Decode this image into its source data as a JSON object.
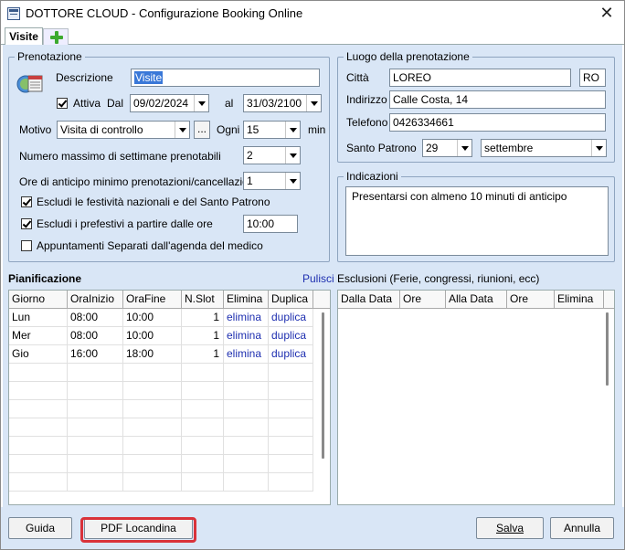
{
  "window": {
    "title": "DOTTORE CLOUD - Configurazione Booking Online",
    "close_glyph": "✕"
  },
  "tabs": [
    {
      "label": "Visite"
    }
  ],
  "prenotazione": {
    "legend": "Prenotazione",
    "descrizione_label": "Descrizione",
    "descrizione_value": "Visite",
    "attiva_label": "Attiva",
    "attiva_checked": true,
    "dal_label": "Dal",
    "dal_value": "09/02/2024",
    "al_label": "al",
    "al_value": "31/03/2100",
    "motivo_label": "Motivo",
    "motivo_value": "Visita di controllo",
    "motivo_button": "...",
    "ogni_label": "Ogni",
    "ogni_value": "15",
    "min_label": "min",
    "settimane_label": "Numero massimo di settimane prenotabili",
    "settimane_value": "2",
    "anticipo_label": "Ore di anticipo minimo prenotazioni/cancellazioni",
    "anticipo_value": "1",
    "escludi_festivita_label": "Escludi le festività nazionali e del Santo Patrono",
    "escludi_festivita_checked": true,
    "escludi_prefestivi_label": "Escludi i prefestivi a partire dalle ore",
    "escludi_prefestivi_checked": true,
    "prefestivi_ore_value": "10:00",
    "appuntamenti_label": "Appuntamenti Separati dall'agenda del medico",
    "appuntamenti_checked": false
  },
  "luogo": {
    "legend": "Luogo della prenotazione",
    "citta_label": "Città",
    "citta_value": "LOREO",
    "provincia_value": "RO",
    "indirizzo_label": "Indirizzo",
    "indirizzo_value": "Calle Costa, 14",
    "telefono_label": "Telefono",
    "telefono_value": "0426334661",
    "patrono_label": "Santo Patrono",
    "patrono_giorno": "29",
    "patrono_mese": "settembre"
  },
  "indicazioni": {
    "legend": "Indicazioni",
    "text": "Presentarsi con almeno 10 minuti di anticipo"
  },
  "pianificazione": {
    "title": "Pianificazione",
    "pulisci_label": "Pulisci",
    "columns": [
      "Giorno",
      "OraInizio",
      "OraFine",
      "N.Slot",
      "Elimina",
      "Duplica"
    ],
    "rows": [
      {
        "giorno": "Lun",
        "inizio": "08:00",
        "fine": "10:00",
        "slot": "1",
        "elimina": "elimina",
        "duplica": "duplica"
      },
      {
        "giorno": "Mer",
        "inizio": "08:00",
        "fine": "10:00",
        "slot": "1",
        "elimina": "elimina",
        "duplica": "duplica"
      },
      {
        "giorno": "Gio",
        "inizio": "16:00",
        "fine": "18:00",
        "slot": "1",
        "elimina": "elimina",
        "duplica": "duplica"
      }
    ]
  },
  "esclusioni": {
    "title": "Esclusioni (Ferie, congressi, riunioni, ecc)",
    "columns": [
      "Dalla Data",
      "Ore",
      "Alla Data",
      "Ore",
      "Elimina"
    ]
  },
  "buttons": {
    "guida": "Guida",
    "pdf": "PDF Locandina",
    "salva": "Salva",
    "annulla": "Annulla"
  },
  "colors": {
    "background": "#d9e6f6",
    "link": "#1e2fb0",
    "highlight": "#d9323a",
    "add_tab": "#3caa2f"
  }
}
